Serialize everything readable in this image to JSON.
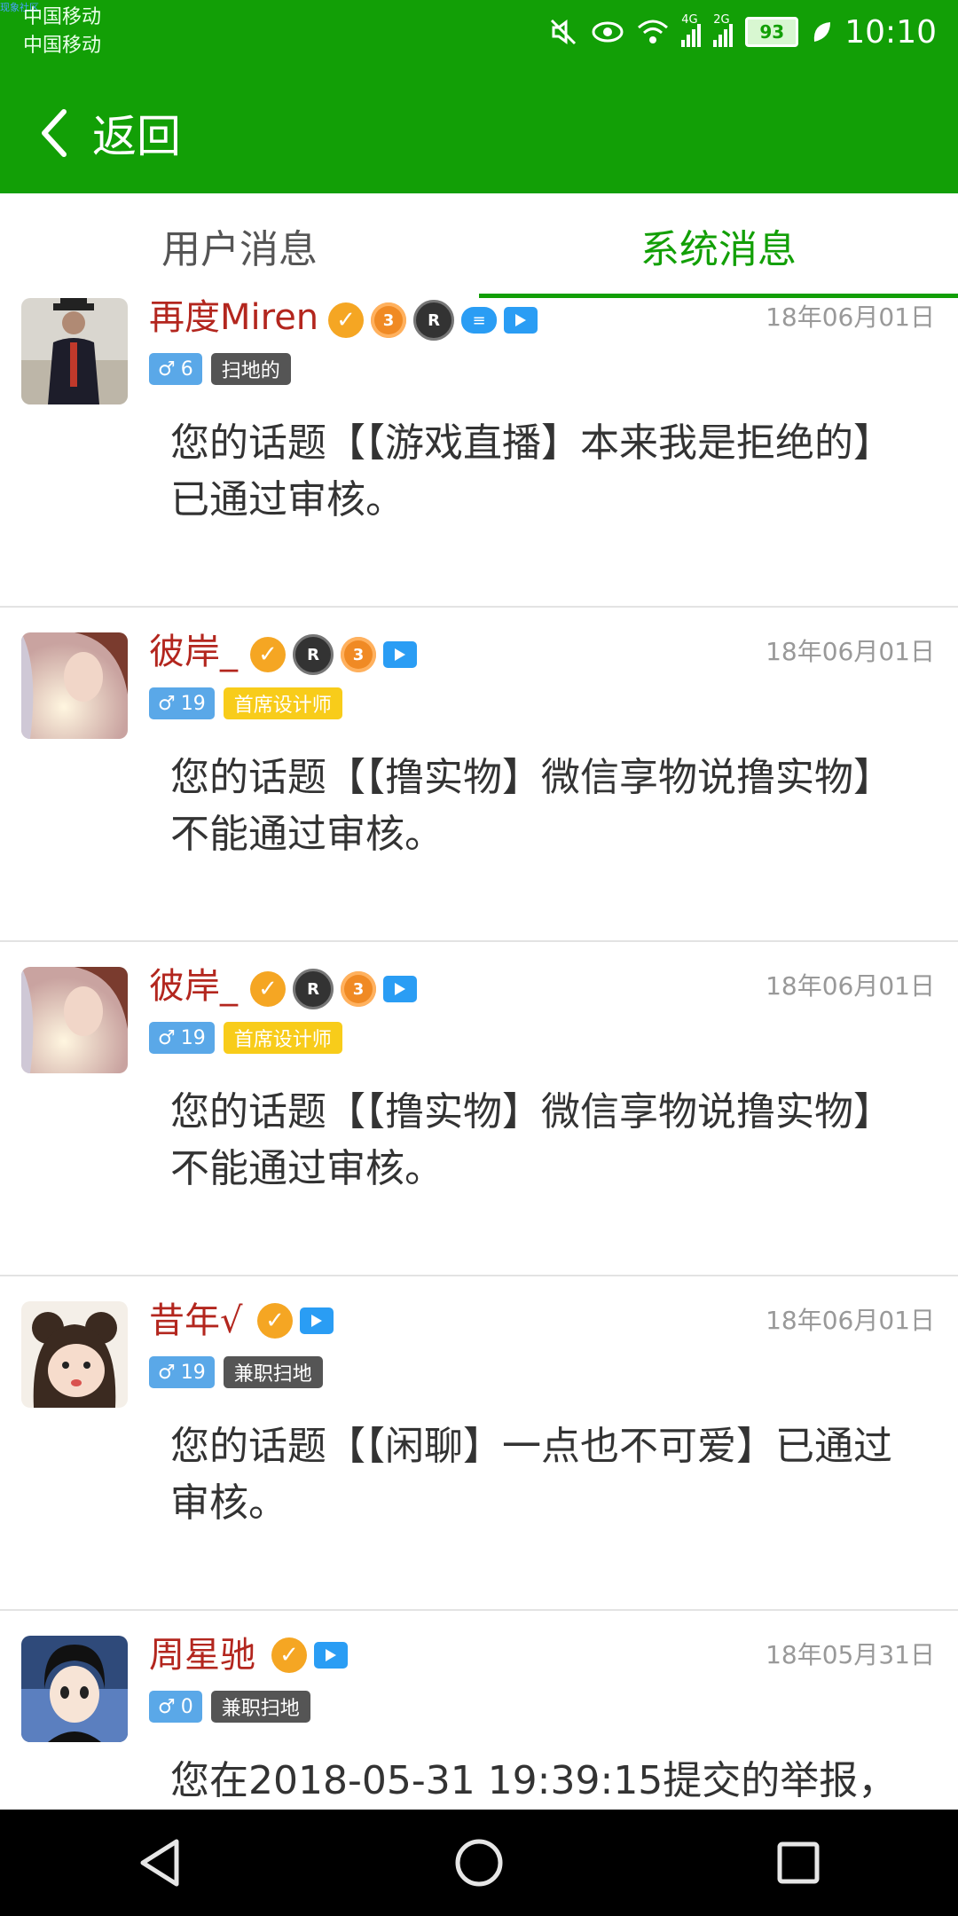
{
  "status_bar": {
    "watermark": "现象社区",
    "carrier_1": "中国移动",
    "carrier_2": "中国移动",
    "network_1": "4G",
    "network_2": "2G",
    "battery": "93",
    "time": "10:10"
  },
  "header": {
    "title": "返回"
  },
  "tabs": [
    {
      "label": "用户消息",
      "active": false
    },
    {
      "label": "系统消息",
      "active": true
    }
  ],
  "messages": [
    {
      "user": "再度Miren",
      "gender": "♂",
      "level": "6",
      "rank": "扫地的",
      "rank_style": "gray",
      "date": "18年06月01日",
      "text": "您的话题【【游戏直播】本来我是拒绝的】已通过审核。",
      "medals": [
        "3",
        "R"
      ]
    },
    {
      "user": "彼岸_",
      "gender": "♂",
      "level": "19",
      "rank": "首席设计师",
      "rank_style": "yellow",
      "date": "18年06月01日",
      "text": "您的话题【【撸实物】微信享物说撸实物】不能通过审核。",
      "medals": [
        "R",
        "3"
      ]
    },
    {
      "user": "彼岸_",
      "gender": "♂",
      "level": "19",
      "rank": "首席设计师",
      "rank_style": "yellow",
      "date": "18年06月01日",
      "text": "您的话题【【撸实物】微信享物说撸实物】不能通过审核。",
      "medals": [
        "R",
        "3"
      ]
    },
    {
      "user": "昔年√",
      "gender": "♂",
      "level": "19",
      "rank": "兼职扫地",
      "rank_style": "gray",
      "date": "18年06月01日",
      "text": "您的话题【【闲聊】一点也不可爱】已通过审核。",
      "medals": []
    },
    {
      "user": "周星驰",
      "gender": "♂",
      "level": "0",
      "rank": "兼职扫地",
      "rank_style": "gray",
      "date": "18年05月31日",
      "text": "您在2018-05-31 19:39:15提交的举报，",
      "medals": []
    }
  ],
  "colors": {
    "brand_green": "#129f06",
    "username_red": "#b3261e"
  }
}
